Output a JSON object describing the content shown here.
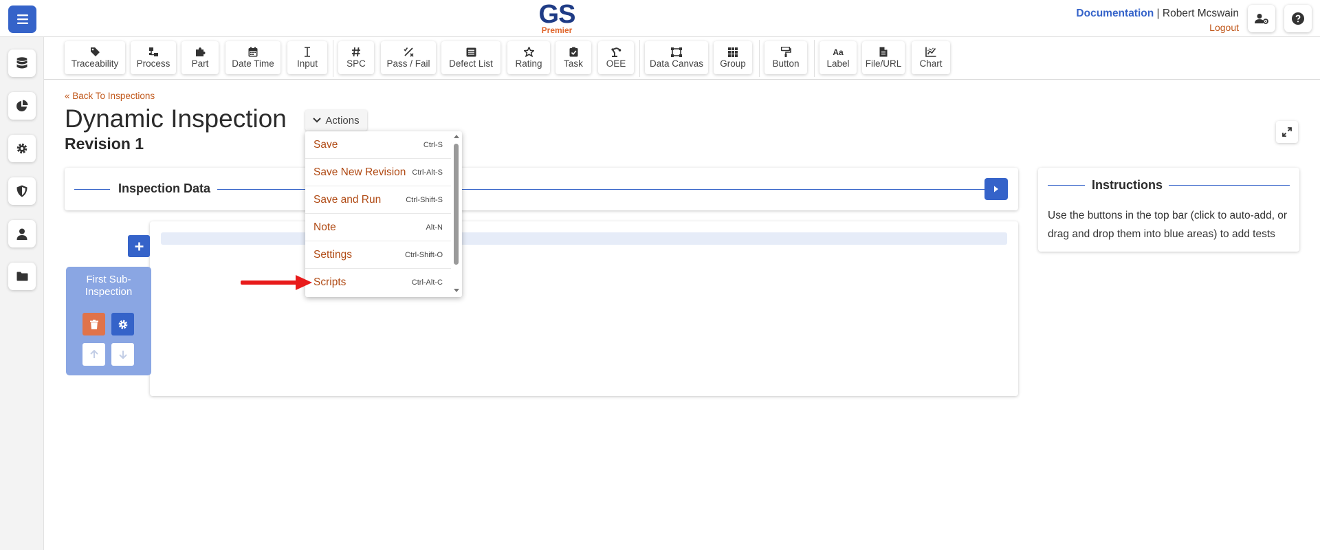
{
  "header": {
    "logo_main": "GS",
    "logo_sub": "Premier",
    "documentation": "Documentation",
    "separator": "|",
    "user_name": "Robert Mcswain",
    "logout": "Logout"
  },
  "sidebar": {
    "items": [
      "database-icon",
      "pie-chart-icon",
      "gear-icon",
      "shield-icon",
      "user-icon",
      "folder-icon"
    ]
  },
  "toolbar": {
    "tools": [
      {
        "label": "Traceability",
        "icon": "tag-icon"
      },
      {
        "label": "Process",
        "icon": "process-icon"
      },
      {
        "label": "Part",
        "icon": "puzzle-icon"
      },
      {
        "label": "Date Time",
        "icon": "calendar-icon"
      },
      {
        "label": "Input",
        "icon": "text-cursor-icon"
      },
      {
        "label": "SPC",
        "icon": "hash-icon"
      },
      {
        "label": "Pass / Fail",
        "icon": "percent-icon"
      },
      {
        "label": "Defect List",
        "icon": "list-icon"
      },
      {
        "label": "Rating",
        "icon": "star-icon"
      },
      {
        "label": "Task",
        "icon": "clipboard-check-icon"
      },
      {
        "label": "OEE",
        "icon": "robot-arm-icon"
      },
      {
        "label": "Data Canvas",
        "icon": "canvas-icon"
      },
      {
        "label": "Group",
        "icon": "grid-icon"
      },
      {
        "label": "Button",
        "icon": "paint-roller-icon"
      },
      {
        "label": "Label",
        "icon": "font-icon"
      },
      {
        "label": "File/URL",
        "icon": "file-icon"
      },
      {
        "label": "Chart",
        "icon": "chart-line-icon"
      }
    ]
  },
  "page": {
    "back_link": "Back To Inspections",
    "title": "Dynamic Inspection",
    "revision": "Revision 1",
    "actions_label": "Actions"
  },
  "actions_menu": {
    "items": [
      {
        "label": "Save",
        "shortcut": "Ctrl-S"
      },
      {
        "label": "Save New Revision",
        "shortcut": "Ctrl-Alt-S"
      },
      {
        "label": "Save and Run",
        "shortcut": "Ctrl-Shift-S"
      },
      {
        "label": "Note",
        "shortcut": "Alt-N"
      },
      {
        "label": "Settings",
        "shortcut": "Ctrl-Shift-O"
      },
      {
        "label": "Scripts",
        "shortcut": "Ctrl-Alt-C"
      }
    ]
  },
  "inspection_data": {
    "title": "Inspection Data"
  },
  "instructions": {
    "title": "Instructions",
    "text": "Use the buttons in the top bar (click to auto-add, or drag and drop them into blue areas) to add tests"
  },
  "sub_inspection": {
    "title": "First Sub-Inspection"
  },
  "colors": {
    "primary": "#3563c9",
    "accent": "#c0571a",
    "danger": "#e0734a",
    "sub_card": "#8aa6e3",
    "annotation_arrow": "#e81a1a"
  }
}
